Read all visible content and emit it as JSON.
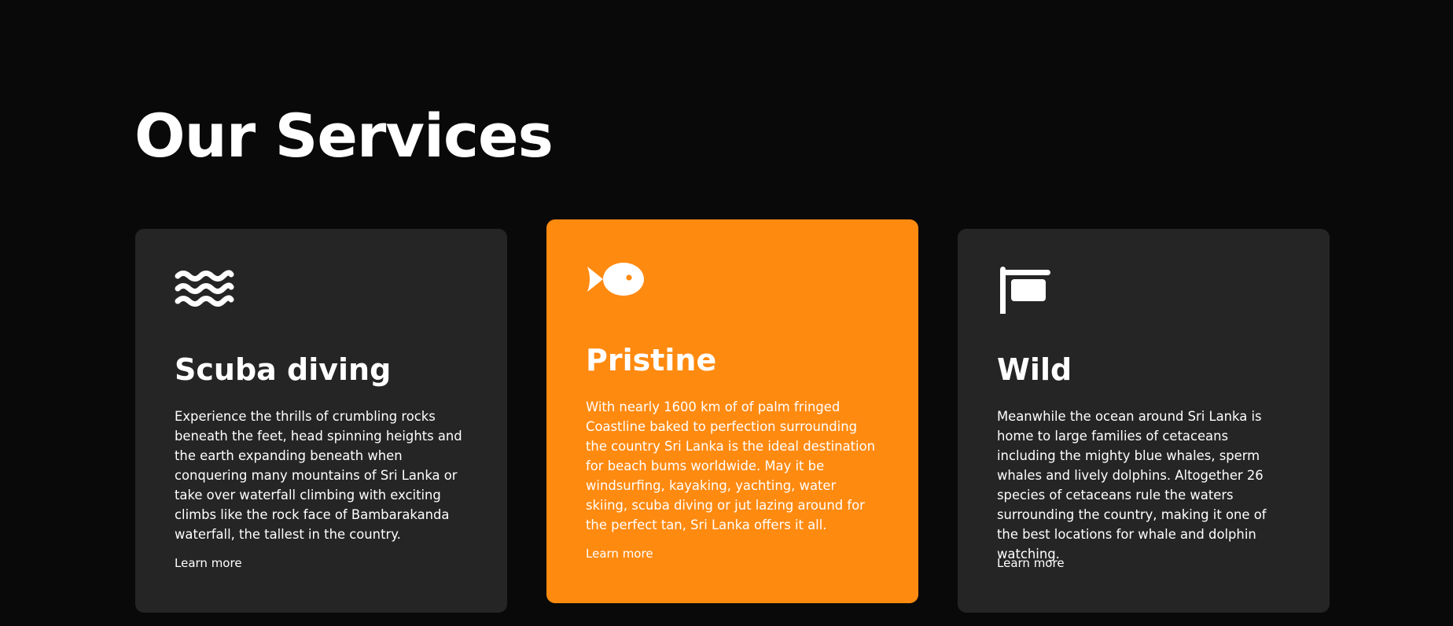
{
  "section": {
    "title": "Our Services"
  },
  "colors": {
    "background": "#090909",
    "card": "#252525",
    "accent": "#ff8a10",
    "text": "#ffffff"
  },
  "cards": [
    {
      "icon": "water-waves-icon",
      "title": "Scuba diving",
      "text": "Experience the thrills of crumbling rocks beneath the feet, head spinning heights and the earth expanding beneath when conquering many mountains of Sri Lanka or take over waterfall climbing with exciting climbs like the rock face of Bambarakanda waterfall, the tallest in the country.",
      "link": "Learn more"
    },
    {
      "icon": "fish-icon",
      "title": "Pristine",
      "text": "With nearly 1600 km of of palm fringed Coastline baked to perfection surrounding the country Sri Lanka is the ideal destination for beach bums worldwide. May it be windsurfing, kayaking, yachting, water skiing, scuba diving or jut lazing around for the perfect tan, Sri Lanka offers it all.",
      "link": "Learn more",
      "highlighted": true
    },
    {
      "icon": "signpost-icon",
      "title": "Wild",
      "text": "Meanwhile the ocean around Sri Lanka is home to large families of cetaceans including the mighty blue whales, sperm whales and lively dolphins. Altogether 26 species of cetaceans rule the waters surrounding the country, making it one of the best locations for whale and dolphin watching.",
      "link": "Learn more"
    }
  ]
}
